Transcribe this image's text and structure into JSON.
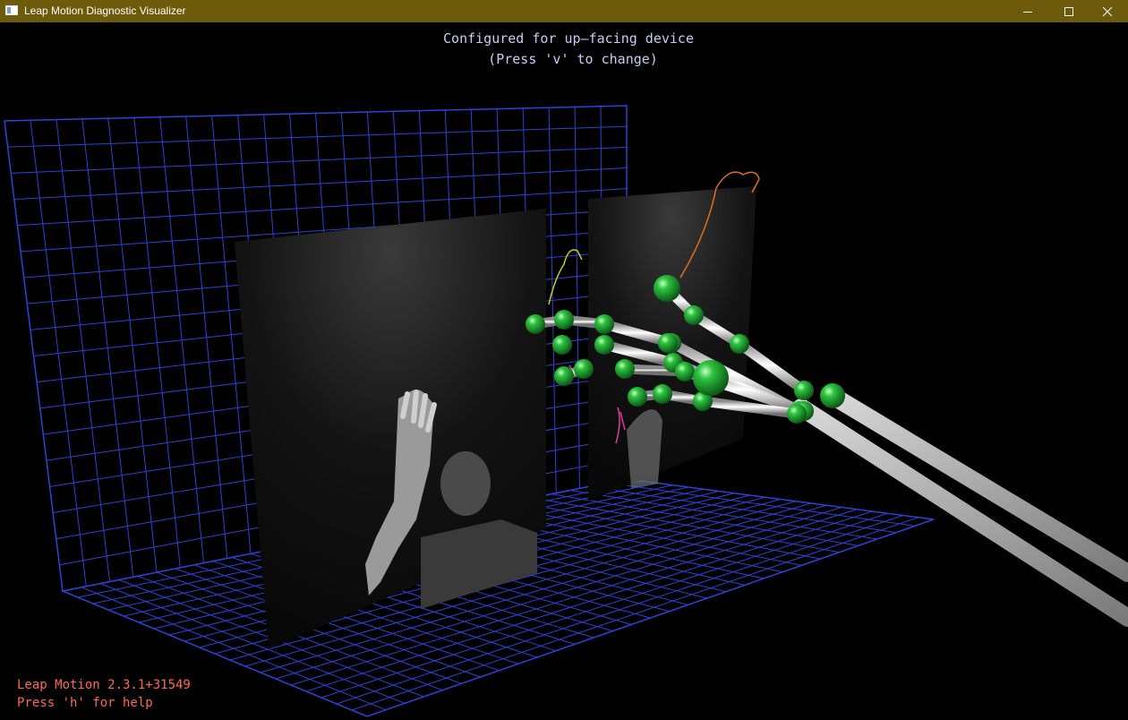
{
  "window": {
    "title": "Leap Motion Diagnostic Visualizer",
    "controls": {
      "minimize": "minimize-icon",
      "maximize": "maximize-icon",
      "close": "close-icon"
    },
    "titlebar_color": "#6e5a0b"
  },
  "overlay": {
    "device_msg": "Configured for up–facing device",
    "change_hint": "(Press 'v' to change)",
    "version": "Leap Motion 2.3.1+31549",
    "help": "Press 'h' for help"
  },
  "colors": {
    "grid": "#2c43d6",
    "joints": "#22a63a",
    "bones": "#d8d8d8",
    "overlay_text": "#c8cdf8",
    "status_text": "#ff6a4a"
  }
}
